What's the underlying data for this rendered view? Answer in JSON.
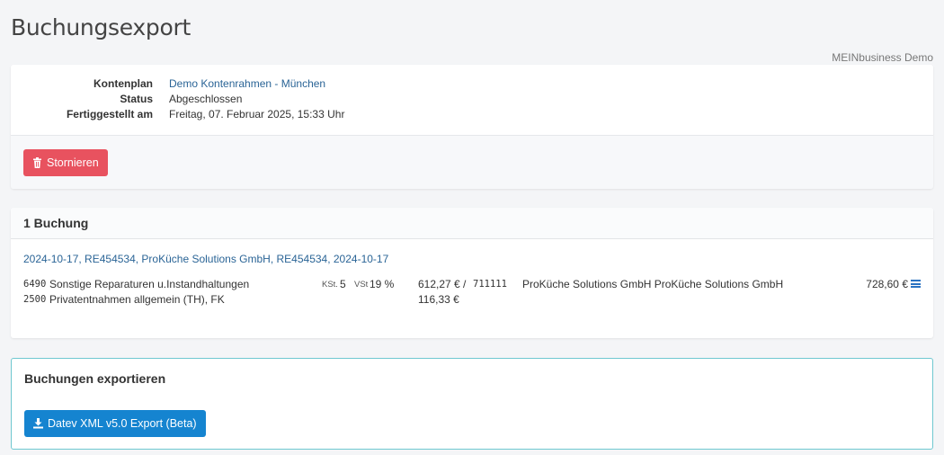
{
  "page": {
    "title": "Buchungsexport",
    "tenant": "MEINbusiness Demo"
  },
  "info": {
    "rows": [
      {
        "label": "Kontenplan",
        "value": "Demo Kontenrahmen - München"
      },
      {
        "label": "Status",
        "value": "Abgeschlossen"
      },
      {
        "label": "Fertiggestellt am",
        "value": "Freitag, 07. Februar 2025, 15:33 Uhr"
      }
    ],
    "cancel_label": "Stornieren"
  },
  "bookings": {
    "count_label": "1 Buchung",
    "items": [
      {
        "link": "2024-10-17, RE454534, ProKüche Solutions GmbH, RE454534, 2024-10-17",
        "lines": [
          {
            "account_no": "6490",
            "account_name": "Sonstige Reparaturen u.Instandhaltungen",
            "amount": "612,27 €"
          },
          {
            "account_no": "2500",
            "account_name": "Privatentnahmen allgemein (TH), FK",
            "amount": "116,33 €"
          }
        ],
        "kst_label": "KSt.",
        "kst_value": "5",
        "vst_label": "VSt",
        "vst_value": "19 %",
        "separator": "/",
        "counter_account_no": "711111",
        "counter_account_name": "ProKüche Solutions GmbH ProKüche Solutions GmbH",
        "total": "728,60 €"
      }
    ]
  },
  "export": {
    "title": "Buchungen exportieren",
    "button_label": "Datev XML v5.0 Export (Beta)"
  },
  "colors": {
    "danger": "#e8525f",
    "primary": "#1584d0",
    "link": "#2a6496",
    "export_border": "#6fc8d0"
  }
}
